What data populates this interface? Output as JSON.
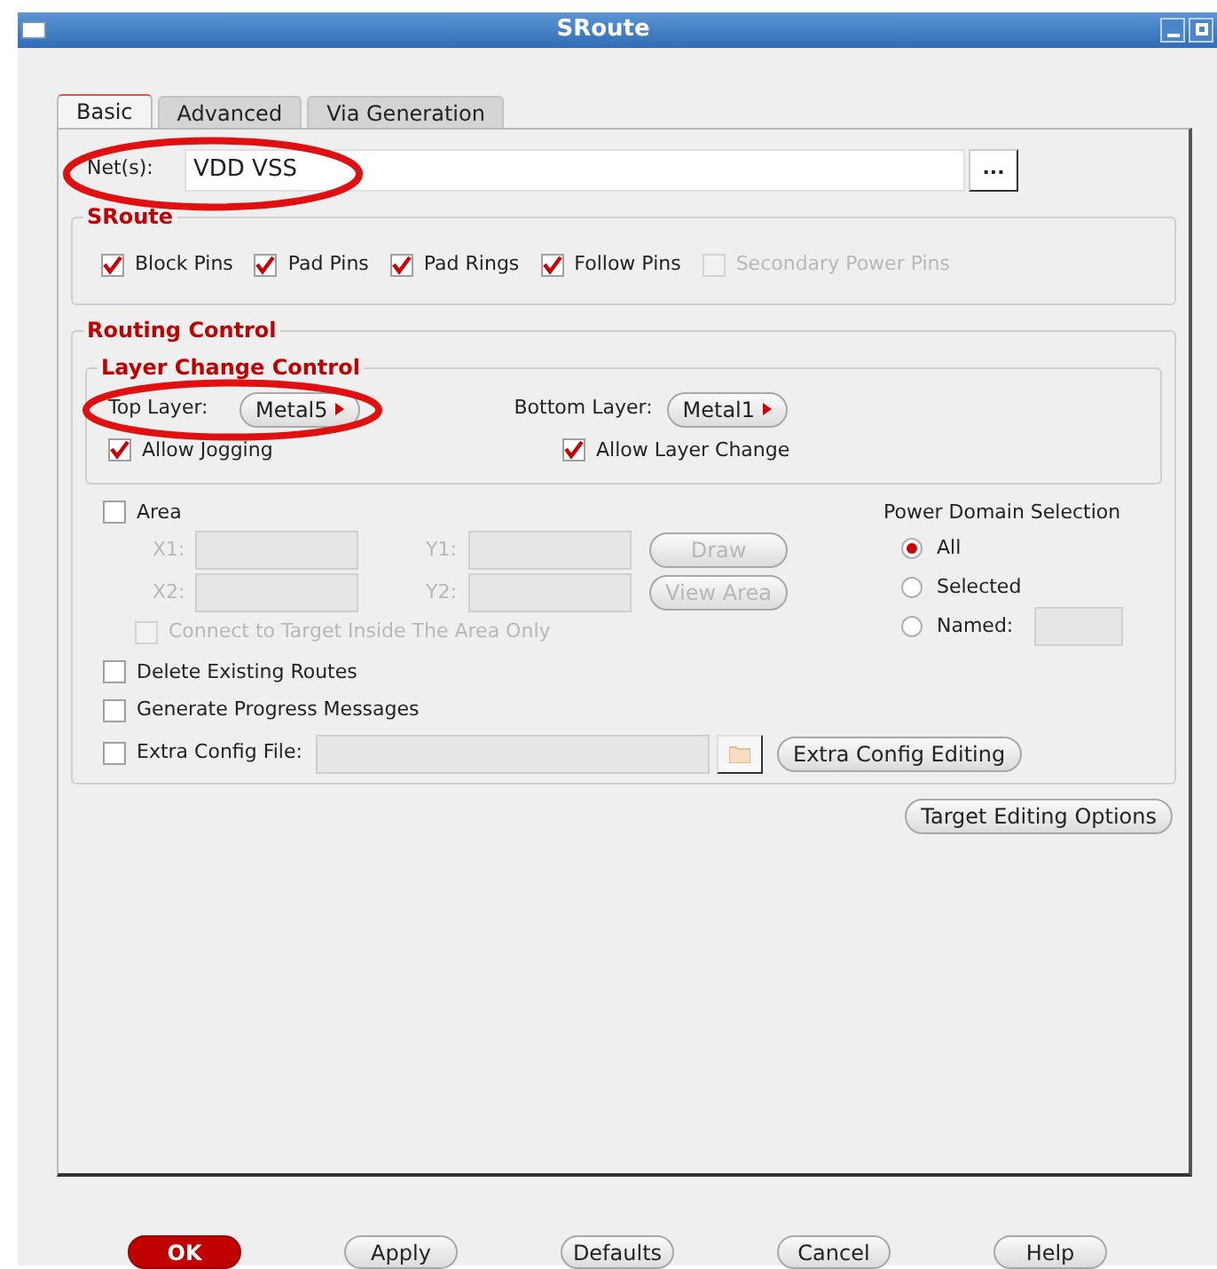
{
  "window": {
    "title": "SRoute"
  },
  "tabs": [
    {
      "label": "Basic",
      "selected": true
    },
    {
      "label": "Advanced",
      "selected": false
    },
    {
      "label": "Via Generation",
      "selected": false
    }
  ],
  "nets": {
    "label": "Net(s):",
    "value": "VDD VSS",
    "browse": "..."
  },
  "sroute": {
    "title": "SRoute",
    "options": [
      {
        "label": "Block Pins",
        "checked": true,
        "disabled": false
      },
      {
        "label": "Pad Pins",
        "checked": true,
        "disabled": false
      },
      {
        "label": "Pad Rings",
        "checked": true,
        "disabled": false
      },
      {
        "label": "Follow Pins",
        "checked": true,
        "disabled": false
      },
      {
        "label": "Secondary Power Pins",
        "checked": false,
        "disabled": true
      }
    ]
  },
  "routing_control": {
    "title": "Routing Control",
    "layer_change_control": {
      "title": "Layer Change Control",
      "top_layer": {
        "label": "Top Layer:",
        "value": "Metal5"
      },
      "bottom_layer": {
        "label": "Bottom Layer:",
        "value": "Metal1"
      },
      "options": [
        {
          "label": "Allow Jogging",
          "checked": true
        },
        {
          "label": "Allow Layer Change",
          "checked": true
        }
      ]
    },
    "area": {
      "label": "Area",
      "checked": false,
      "x1": "X1:",
      "y1": "Y1:",
      "x2": "X2:",
      "y2": "Y2:",
      "draw": "Draw",
      "view": "View Area",
      "connect": {
        "label": "Connect to Target Inside The Area Only",
        "checked": false
      }
    },
    "power_domain": {
      "title": "Power Domain Selection",
      "options": [
        {
          "label": "All",
          "selected": true
        },
        {
          "label": "Selected",
          "selected": false
        },
        {
          "label": "Named:",
          "selected": false
        }
      ]
    },
    "options": [
      {
        "label": "Delete Existing Routes",
        "checked": false
      },
      {
        "label": "Generate Progress Messages",
        "checked": false
      }
    ],
    "extra_config": {
      "label": "Extra Config File:",
      "checked": false,
      "button": "Extra Config Editing"
    }
  },
  "target_button": "Target Editing Options",
  "footer": [
    {
      "label": "OK",
      "kind": "primary"
    },
    {
      "label": "Apply",
      "kind": "normal"
    },
    {
      "label": "Defaults",
      "kind": "normal"
    },
    {
      "label": "Cancel",
      "kind": "normal"
    },
    {
      "label": "Help",
      "kind": "normal"
    }
  ]
}
